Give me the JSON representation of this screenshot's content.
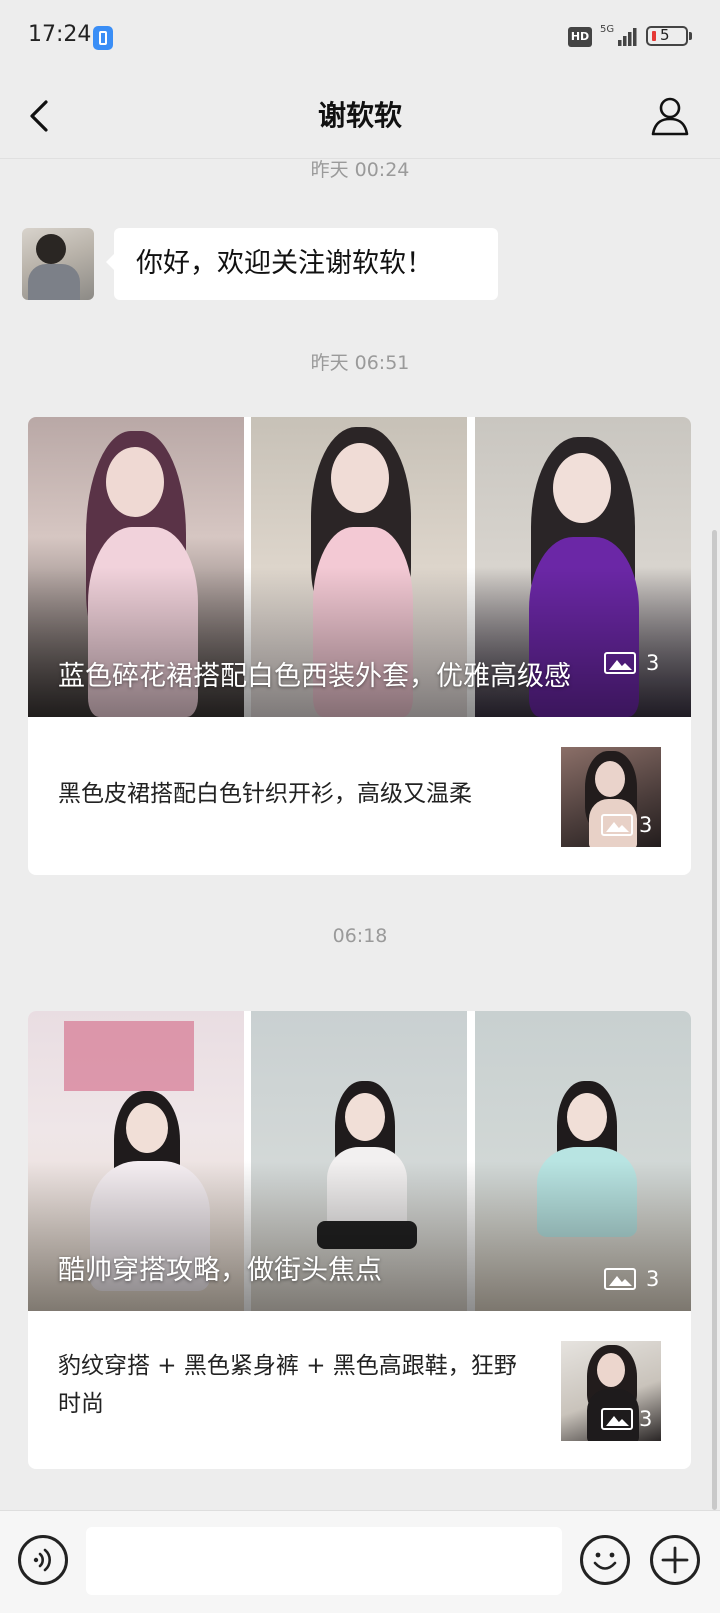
{
  "status_bar": {
    "time": "17:24",
    "hd_badge": "HD",
    "network": "5G",
    "battery_level": "5"
  },
  "nav": {
    "title": "谢软软",
    "back_icon": "chevron-left-icon",
    "profile_icon": "person-icon"
  },
  "messages": [
    {
      "type": "timestamp",
      "text": "昨天 00:24"
    },
    {
      "type": "text",
      "text": "你好，欢迎关注谢软软！"
    },
    {
      "type": "timestamp",
      "text": "昨天 06:51"
    },
    {
      "type": "article",
      "cover_title": "蓝色碎花裙搭配白色西装外套，优雅高级感",
      "cover_image_count": "3",
      "sub_items": [
        {
          "title": "黑色皮裙搭配白色针织开衫，高级又温柔",
          "image_count": "3"
        }
      ]
    },
    {
      "type": "timestamp",
      "text": "06:18"
    },
    {
      "type": "article",
      "cover_title": "酷帅穿搭攻略，做街头焦点",
      "cover_image_count": "3",
      "sub_items": [
        {
          "title": "豹纹穿搭 + 黑色紧身裤 + 黑色高跟鞋，狂野时尚",
          "image_count": "3"
        }
      ]
    }
  ],
  "input_bar": {
    "text_value": "",
    "voice_icon": "voice-icon",
    "emoji_icon": "emoji-icon",
    "plus_icon": "plus-icon"
  },
  "colors": {
    "background": "#ededed",
    "bubble": "#ffffff",
    "timestamp_text": "#9a9a9a",
    "battery_low": "#e53935"
  }
}
